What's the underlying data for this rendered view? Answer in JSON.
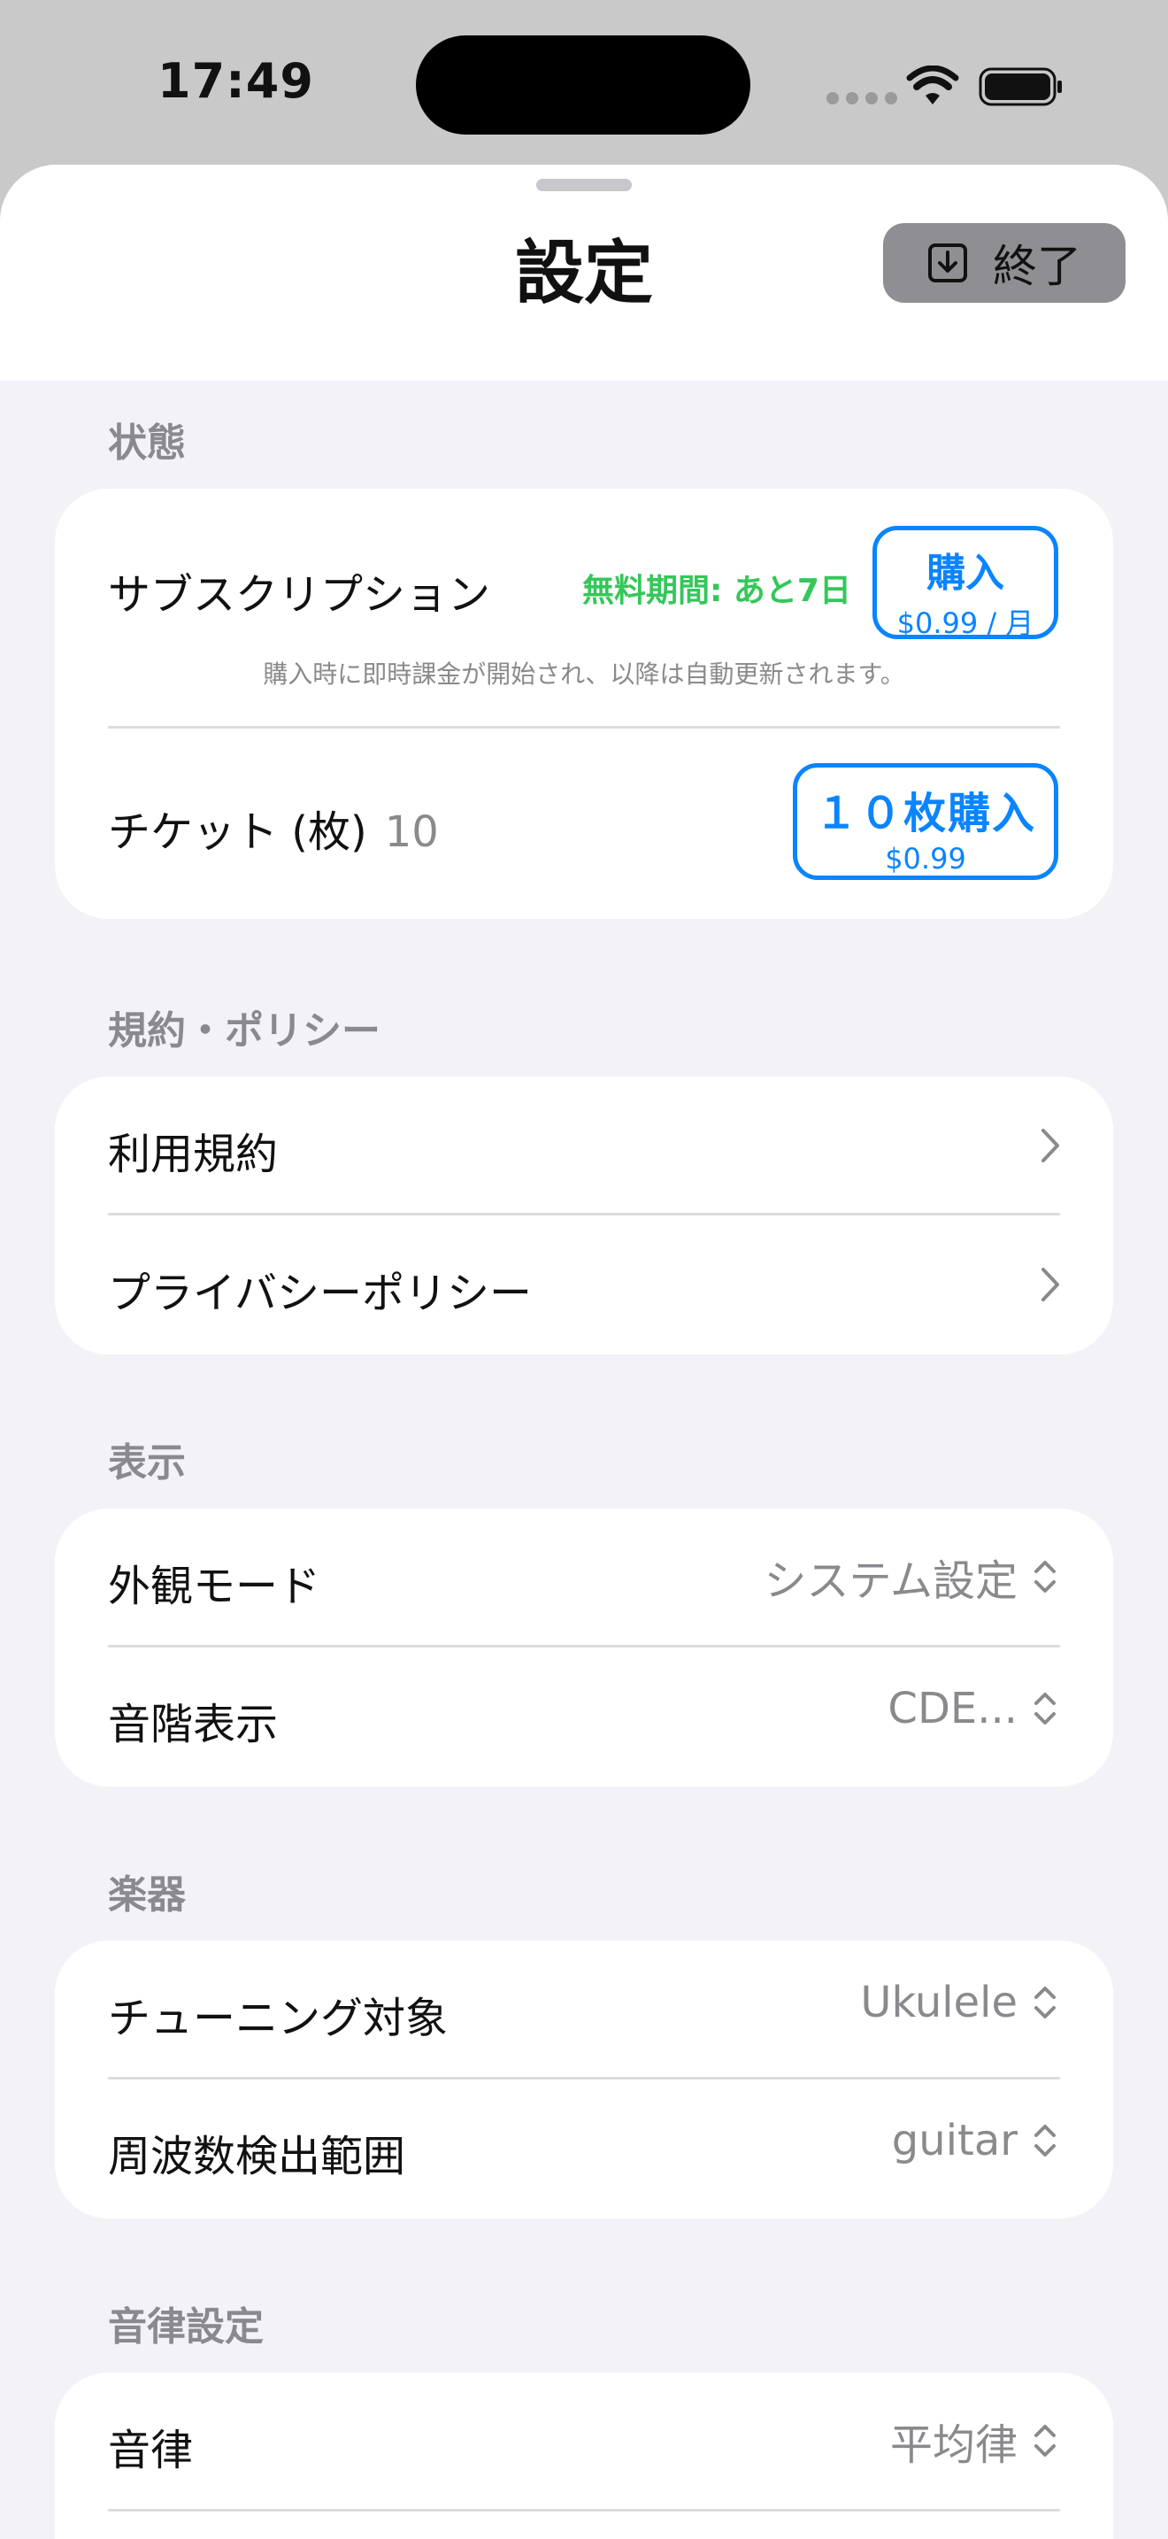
{
  "status_bar": {
    "time": "17:49"
  },
  "header": {
    "title": "設定",
    "done_label": "終了"
  },
  "sections": {
    "status": {
      "label": "状態",
      "subscription": {
        "label": "サブスクリプション",
        "trial_text": "無料期間: あと7日",
        "buy_label": "購入",
        "buy_price": "$0.99 / 月",
        "note": "購入時に即時課金が開始され、以降は自動更新されます。"
      },
      "tickets": {
        "label": "チケット (枚)",
        "count": "10",
        "buy_label": "１０枚購入",
        "buy_price": "$0.99"
      }
    },
    "policy": {
      "label": "規約・ポリシー",
      "items": [
        "利用規約",
        "プライバシーポリシー"
      ]
    },
    "display": {
      "label": "表示",
      "appearance": {
        "label": "外観モード",
        "value": "システム設定"
      },
      "scale": {
        "label": "音階表示",
        "value": "CDE..."
      }
    },
    "instrument": {
      "label": "楽器",
      "target": {
        "label": "チューニング対象",
        "value": "Ukulele"
      },
      "range": {
        "label": "周波数検出範囲",
        "value": "guitar"
      }
    },
    "temperament": {
      "label": "音律設定",
      "temperament": {
        "label": "音律",
        "value": "平均律"
      }
    }
  },
  "colors": {
    "accent": "#0a84ff",
    "trial_green": "#34c759",
    "background": "#f2f2f7"
  }
}
